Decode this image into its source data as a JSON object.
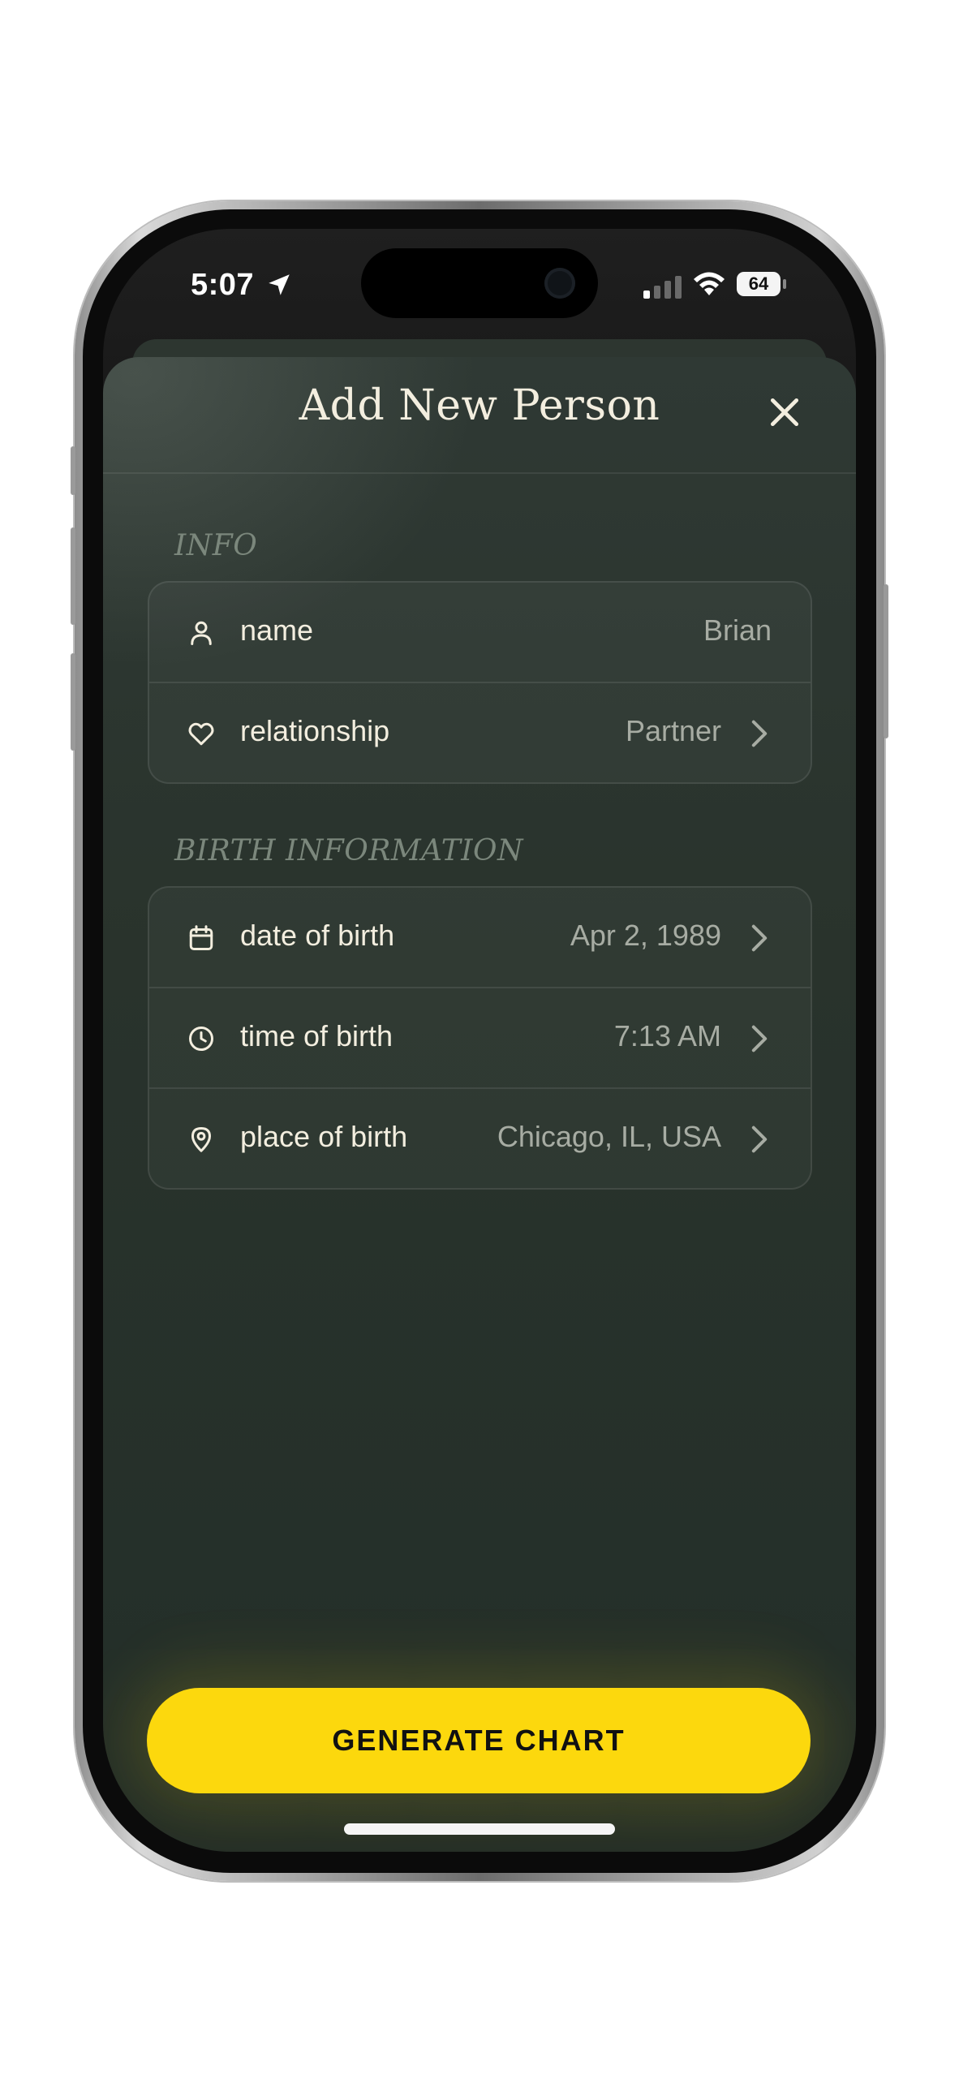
{
  "status_bar": {
    "time": "5:07",
    "battery": "64"
  },
  "sheet": {
    "title": "Add New Person"
  },
  "sections": {
    "info": {
      "label": "INFO",
      "rows": [
        {
          "icon": "person-icon",
          "label": "name",
          "value": "Brian"
        },
        {
          "icon": "heart-icon",
          "label": "relationship",
          "value": "Partner"
        }
      ]
    },
    "birth": {
      "label": "BIRTH INFORMATION",
      "rows": [
        {
          "icon": "calendar-icon",
          "label": "date of birth",
          "value": "Apr 2, 1989"
        },
        {
          "icon": "clock-icon",
          "label": "time of birth",
          "value": "7:13 AM"
        },
        {
          "icon": "map-pin-icon",
          "label": "place of birth",
          "value": "Chicago, IL, USA"
        }
      ]
    }
  },
  "cta": {
    "label": "GENERATE CHART"
  },
  "colors": {
    "accent": "#fcd80d",
    "sheet_bg": "#29332c",
    "text": "#f3eedf",
    "muted": "#a7aca3"
  }
}
